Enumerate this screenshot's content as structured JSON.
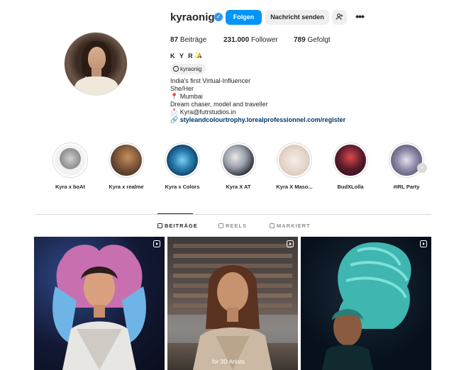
{
  "profile": {
    "username": "kyraonig",
    "follow_label": "Folgen",
    "message_label": "Nachricht senden",
    "suggest_icon": "add-person-icon",
    "more_icon": "more-icon"
  },
  "stats": {
    "posts_count": "87",
    "posts_label": "Beiträge",
    "followers_count": "231.000",
    "followers_label": "Follower",
    "following_count": "789",
    "following_label": "Gefolgt"
  },
  "bio": {
    "full_name": "K Y R A",
    "threads_handle": "kyraonig",
    "line1": "India's first Virtual-Influencer",
    "line2": "She/Her",
    "line3": "Mumbai",
    "line4": "Dream chaser, model and traveller",
    "line5": "Kyra@futrstudios.in",
    "link": "styleandcolourtrophy.lorealprofessionnel.com/register"
  },
  "highlights": [
    {
      "label": "Kyra x boAt"
    },
    {
      "label": "Kyra x realme"
    },
    {
      "label": "Kyra x Colors"
    },
    {
      "label": "Kyra X AT"
    },
    {
      "label": "Kyra X Maso..."
    },
    {
      "label": "BudXLolla"
    },
    {
      "label": "#IRL Party"
    }
  ],
  "tabs": [
    {
      "label": "BEITRÄGE"
    },
    {
      "label": "REELS"
    },
    {
      "label": "MARKIERT"
    }
  ],
  "posts": [
    {
      "caption": ""
    },
    {
      "caption": "for 3D Artists."
    },
    {
      "caption": ""
    }
  ],
  "colors": {
    "accent": "#0095f6",
    "link": "#00376b",
    "verified": "#3897f0"
  }
}
